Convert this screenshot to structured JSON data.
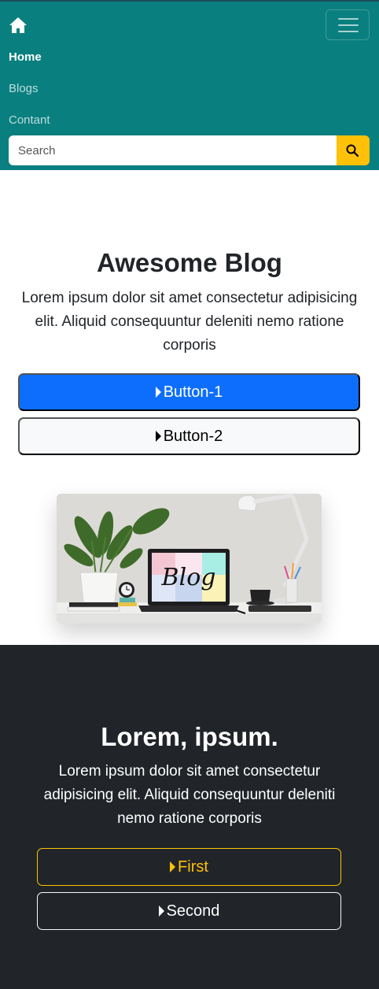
{
  "nav": {
    "brand_icon": "home-icon",
    "toggler_icon": "hamburger-icon",
    "links": [
      {
        "label": "Home",
        "active": true
      },
      {
        "label": "Blogs",
        "active": false
      },
      {
        "label": "Contant",
        "active": false
      }
    ],
    "search": {
      "placeholder": "Search",
      "value": "",
      "button_icon": "search-icon"
    },
    "colors": {
      "background": "#0a7f7f",
      "search_button": "#ffc107"
    }
  },
  "hero": {
    "title": "Awesome Blog",
    "text": "Lorem ipsum dolor sit amet consectetur adipisicing elit. Aliquid consequuntur deleniti nemo ratione corporis",
    "buttons": [
      {
        "label": "Button-1",
        "icon": "caret-right-icon",
        "color": "#0d6efd"
      },
      {
        "label": "Button-2",
        "icon": "caret-right-icon",
        "color": "#f8f9fa"
      }
    ],
    "image_text": "Blog"
  },
  "dark_section": {
    "title": "Lorem, ipsum.",
    "text": "Lorem ipsum dolor sit amet consectetur adipisicing elit. Aliquid consequuntur deleniti nemo ratione corporis",
    "buttons": [
      {
        "label": "First",
        "icon": "caret-right-icon",
        "color": "#ffc107"
      },
      {
        "label": "Second",
        "icon": "caret-right-icon",
        "color": "#f8f9fa"
      }
    ],
    "colors": {
      "background": "#212529"
    }
  }
}
